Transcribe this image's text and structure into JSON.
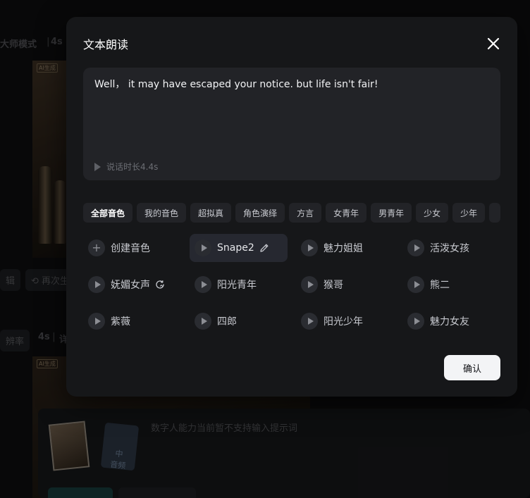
{
  "background": {
    "mode_label": "大师模式",
    "duration_label": "4s",
    "button_edit": "辑",
    "button_regen": "再次生",
    "resolution_label": "辨率",
    "duration_label_2": "4s",
    "partial_label": "详",
    "ai_tag": "AI生成",
    "ai_tag_2": "AI生成",
    "notice_text": "数字人能力当前暂不支持输入提示词",
    "file_icon_label": "音频",
    "file_icon_glyph": "中"
  },
  "modal": {
    "title": "文本朗读",
    "close_icon": "close-icon",
    "text_content": "Well， it may have escaped your notice. but life isn't fair!",
    "duration_text": "说话时长4.4s",
    "tabs": [
      {
        "label": "全部音色",
        "active": true
      },
      {
        "label": "我的音色",
        "active": false
      },
      {
        "label": "超拟真",
        "active": false
      },
      {
        "label": "角色演绎",
        "active": false
      },
      {
        "label": "方言",
        "active": false
      },
      {
        "label": "女青年",
        "active": false
      },
      {
        "label": "男青年",
        "active": false
      },
      {
        "label": "少女",
        "active": false
      },
      {
        "label": "少年",
        "active": false
      }
    ],
    "voices": [
      {
        "label": "创建音色",
        "icon": "plus-icon"
      },
      {
        "label": "Snape2",
        "icon": "play-icon",
        "suffix_icon": "edit-icon",
        "selected": true
      },
      {
        "label": "魅力姐姐",
        "icon": "play-icon"
      },
      {
        "label": "活泼女孩",
        "icon": "play-icon"
      },
      {
        "label": "妩媚女声",
        "icon": "play-icon",
        "suffix_icon": "refresh-icon"
      },
      {
        "label": "阳光青年",
        "icon": "play-icon"
      },
      {
        "label": "猴哥",
        "icon": "play-icon"
      },
      {
        "label": "熊二",
        "icon": "play-icon"
      },
      {
        "label": "紫薇",
        "icon": "play-icon"
      },
      {
        "label": "四郎",
        "icon": "play-icon"
      },
      {
        "label": "阳光少年",
        "icon": "play-icon"
      },
      {
        "label": "魅力女友",
        "icon": "play-icon"
      }
    ],
    "confirm_label": "确认"
  },
  "colors": {
    "modal_bg": "#161719",
    "textbox_bg": "#222327",
    "tab_bg": "#222327",
    "selected_bg": "#262830",
    "confirm_bg": "#f3f4f6"
  }
}
